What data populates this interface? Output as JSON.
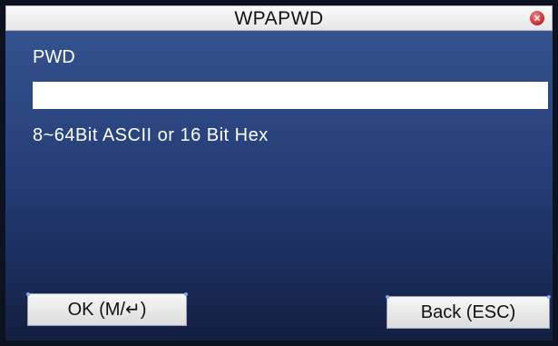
{
  "window": {
    "title": "WPAPWD"
  },
  "form": {
    "pwd_label": "PWD",
    "pwd_value": "",
    "hint": "8~64Bit ASCII or 16 Bit Hex"
  },
  "buttons": {
    "ok_label": "OK (M/↵)",
    "back_label": "Back (ESC)"
  },
  "icons": {
    "close": "close-icon"
  },
  "colors": {
    "title_bar": "#efefef",
    "screen_top": "#34528f",
    "screen_bottom": "#131f40",
    "close_red": "#c0282a"
  }
}
